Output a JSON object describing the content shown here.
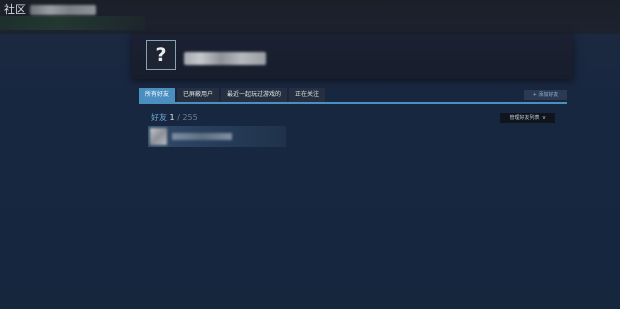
{
  "header": {
    "section_label": "社区"
  },
  "profile": {
    "avatar_glyph": "?"
  },
  "tabs": [
    {
      "label": "所有好友",
      "active": true
    },
    {
      "label": "已屏蔽用户",
      "active": false
    },
    {
      "label": "最近一起玩过游戏的",
      "active": false
    },
    {
      "label": "正在关注",
      "active": false
    }
  ],
  "actions": {
    "add_friend_label": "+ 添加好友",
    "manage_friends_label": "管理好友列表",
    "manage_chevron": "v"
  },
  "friends": {
    "label": "好友",
    "count": "1",
    "separator": "/",
    "max": "255"
  },
  "colors": {
    "accent": "#4a8fc0",
    "background": "#17243a",
    "friends_label": "#6fa8d6"
  }
}
